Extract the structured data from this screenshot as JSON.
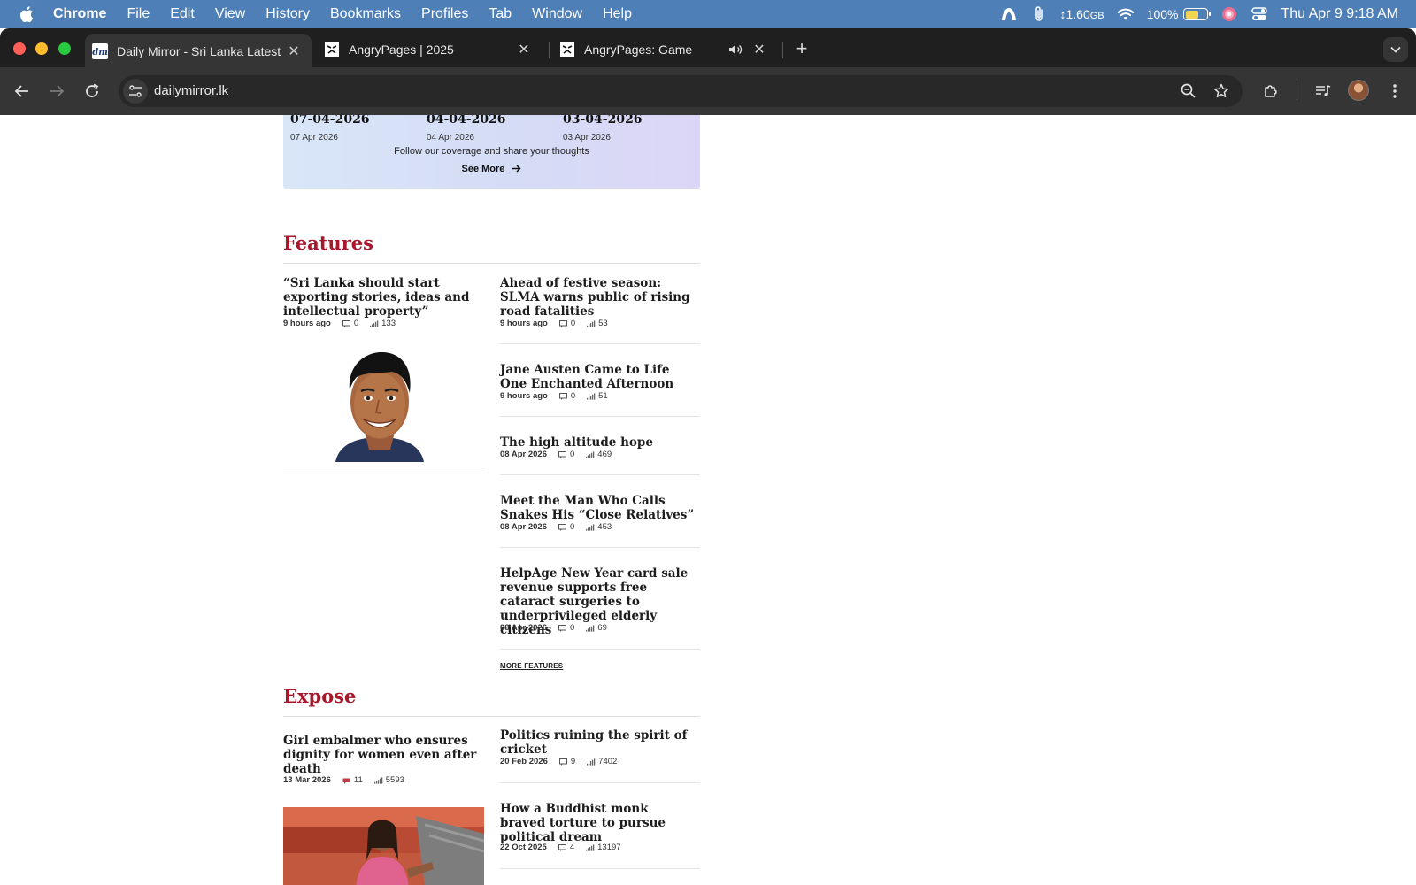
{
  "menubar": {
    "app": "Chrome",
    "items": [
      "File",
      "Edit",
      "View",
      "History",
      "Bookmarks",
      "Profiles",
      "Tab",
      "Window",
      "Help"
    ],
    "memory_value": "1.60",
    "memory_unit": "GB",
    "battery": "100%",
    "battery_level": 0.62,
    "clock": "Thu Apr 9  9:18 AM"
  },
  "tabs": [
    {
      "title": "Daily Mirror - Sri Lanka Latest",
      "favicon": "dm-logo-icon",
      "active": true
    },
    {
      "title": "AngryPages | 2025",
      "favicon": "angrypages-icon",
      "active": false
    },
    {
      "title": "AngryPages: Game",
      "favicon": "angrypages-icon",
      "active": false,
      "audio": true
    }
  ],
  "omnibox": {
    "url": "dailymirror.lk"
  },
  "banner": {
    "dates": [
      {
        "big": "07-04-2026",
        "small": "07 Apr 2026"
      },
      {
        "big": "04-04-2026",
        "small": "04 Apr 2026"
      },
      {
        "big": "03-04-2026",
        "small": "03 Apr 2026"
      }
    ],
    "follow_text": "Follow our coverage and share your thoughts",
    "see_more": "See More"
  },
  "features": {
    "title": "Features",
    "lead": {
      "headline": "“Sri Lanka should start exporting stories, ideas and intellectual property”",
      "date": "9 hours ago",
      "comments": "0",
      "views": "133"
    },
    "items": [
      {
        "headline": "Ahead of festive season: SLMA warns public of rising road fatalities",
        "date": "9 hours ago",
        "comments": "0",
        "views": "53"
      },
      {
        "headline": "Jane Austen Came to Life One Enchanted Afternoon",
        "date": "9 hours ago",
        "comments": "0",
        "views": "51"
      },
      {
        "headline": "The high altitude hope",
        "date": "08 Apr 2026",
        "comments": "0",
        "views": "469"
      },
      {
        "headline": "Meet the Man Who Calls Snakes His “Close Relatives”",
        "date": "08 Apr 2026",
        "comments": "0",
        "views": "453"
      },
      {
        "headline": "HelpAge New Year card sale revenue supports free cataract surgeries to underprivileged elderly citizens",
        "date": "08 Apr 2026",
        "comments": "0",
        "views": "69"
      }
    ],
    "more_link": "MORE FEATURES"
  },
  "expose": {
    "title": "Expose",
    "lead": {
      "headline": "Girl embalmer who ensures dignity for women even after death",
      "date": "13 Mar 2026",
      "comments": "11",
      "views": "5593"
    },
    "items": [
      {
        "headline": "Politics ruining the spirit of cricket",
        "date": "20 Feb 2026",
        "comments": "9",
        "views": "7402"
      },
      {
        "headline": "How a Buddhist monk braved torture to pursue political dream",
        "date": "22 Oct 2025",
        "comments": "4",
        "views": "13197"
      }
    ]
  },
  "colors": {
    "section_red": "#a8172b",
    "menubar_blue": "#4f7fb7",
    "chrome_dark": "#1f1f1f",
    "chrome_toolbar": "#353535"
  }
}
